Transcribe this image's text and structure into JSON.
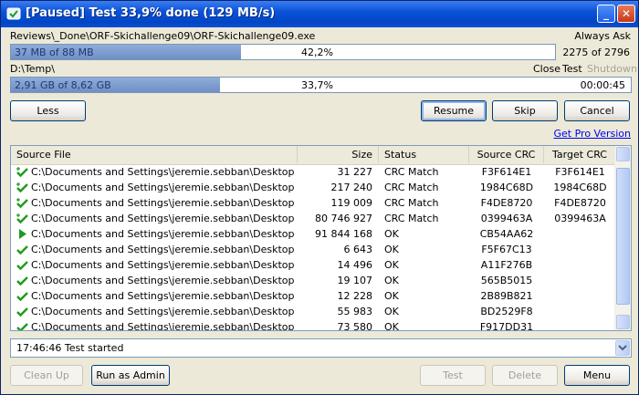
{
  "window": {
    "title": "[Paused] Test 33,9% done (129 MB/s)",
    "minimize": "_",
    "close": "✕"
  },
  "file": {
    "path": "Reviews\\_Done\\ORF-Skichallenge09\\ORF-Skichallenge09.exe",
    "mode": "Always Ask",
    "progress_text": "37 MB of 88 MB",
    "progress_percent": "42,2%",
    "progress_fraction": 0.422,
    "count": "2275 of 2796"
  },
  "total": {
    "path": "D:\\Temp\\",
    "opt_close": "Close",
    "opt_test": "Test",
    "opt_shutdown": "Shutdown",
    "progress_text": "2,91 GB of 8,62 GB",
    "progress_percent": "33,7%",
    "progress_fraction": 0.337,
    "time": "00:00:45"
  },
  "buttons": {
    "less": "Less",
    "resume": "Resume",
    "skip": "Skip",
    "cancel": "Cancel",
    "clean_up": "Clean Up",
    "run_as_admin": "Run as Admin",
    "test": "Test",
    "delete": "Delete",
    "menu": "Menu"
  },
  "links": {
    "get_pro": "Get Pro Version"
  },
  "table": {
    "headers": {
      "source": "Source File",
      "size": "Size",
      "status": "Status",
      "source_crc": "Source CRC",
      "target_crc": "Target CRC"
    },
    "rows": [
      {
        "icon": "check-plus",
        "source": "C:\\Documents and Settings\\jeremie.sebban\\Desktop\\Revi...",
        "size": "31 227",
        "status": "CRC Match",
        "source_crc": "F3F614E1",
        "target_crc": "F3F614E1"
      },
      {
        "icon": "check-plus",
        "source": "C:\\Documents and Settings\\jeremie.sebban\\Desktop\\Revi...",
        "size": "217 240",
        "status": "CRC Match",
        "source_crc": "1984C68D",
        "target_crc": "1984C68D"
      },
      {
        "icon": "check-plus",
        "source": "C:\\Documents and Settings\\jeremie.sebban\\Desktop\\Revi...",
        "size": "119 009",
        "status": "CRC Match",
        "source_crc": "F4DE8720",
        "target_crc": "F4DE8720"
      },
      {
        "icon": "check-plus",
        "source": "C:\\Documents and Settings\\jeremie.sebban\\Desktop\\Revi...",
        "size": "80 746 927",
        "status": "CRC Match",
        "source_crc": "0399463A",
        "target_crc": "0399463A"
      },
      {
        "icon": "play",
        "source": "C:\\Documents and Settings\\jeremie.sebban\\Desktop\\Revi...",
        "size": "91 844 168",
        "status": "OK",
        "source_crc": "CB54AA62",
        "target_crc": ""
      },
      {
        "icon": "check",
        "source": "C:\\Documents and Settings\\jeremie.sebban\\Desktop\\Revi...",
        "size": "6 643",
        "status": "OK",
        "source_crc": "F5F67C13",
        "target_crc": ""
      },
      {
        "icon": "check",
        "source": "C:\\Documents and Settings\\jeremie.sebban\\Desktop\\Revi...",
        "size": "14 496",
        "status": "OK",
        "source_crc": "A11F276B",
        "target_crc": ""
      },
      {
        "icon": "check",
        "source": "C:\\Documents and Settings\\jeremie.sebban\\Desktop\\Revi...",
        "size": "19 107",
        "status": "OK",
        "source_crc": "565B5015",
        "target_crc": ""
      },
      {
        "icon": "check",
        "source": "C:\\Documents and Settings\\jeremie.sebban\\Desktop\\Revi...",
        "size": "12 228",
        "status": "OK",
        "source_crc": "2B89B821",
        "target_crc": ""
      },
      {
        "icon": "check",
        "source": "C:\\Documents and Settings\\jeremie.sebban\\Desktop\\Revi...",
        "size": "55 983",
        "status": "OK",
        "source_crc": "BD2529F8",
        "target_crc": ""
      },
      {
        "icon": "check",
        "source": "C:\\Documents and Settings\\jeremie.sebban\\Desktop\\Revi...",
        "size": "73 580",
        "status": "OK",
        "source_crc": "F917DD31",
        "target_crc": ""
      }
    ]
  },
  "status_log": {
    "text": "17:46:46 Test started"
  },
  "colors": {
    "titlebar": "#0a52d8",
    "progress_fill": "#7f9ccd",
    "check_green": "#1f9a1f",
    "link": "#0000ee"
  }
}
